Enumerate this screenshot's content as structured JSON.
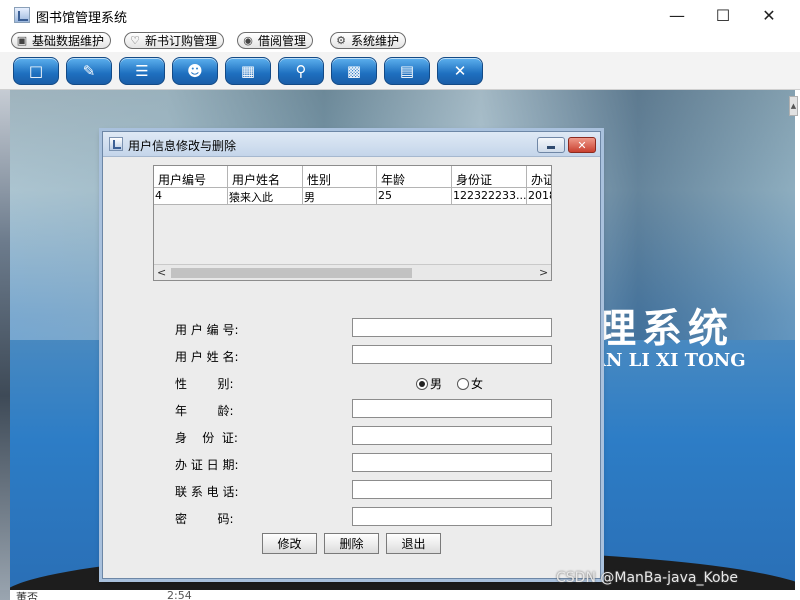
{
  "window": {
    "title": "图书馆管理系统"
  },
  "menu": [
    {
      "label": "基础数据维护",
      "icon": "cube-icon"
    },
    {
      "label": "新书订购管理",
      "icon": "cart-icon"
    },
    {
      "label": "借阅管理",
      "icon": "lock-icon"
    },
    {
      "label": "系统维护",
      "icon": "gears-icon"
    }
  ],
  "toolbar": [
    {
      "icon": "book-icon"
    },
    {
      "icon": "edit-icon"
    },
    {
      "icon": "books-icon"
    },
    {
      "icon": "reader-icon"
    },
    {
      "icon": "box-icon"
    },
    {
      "icon": "search-icon"
    },
    {
      "icon": "monitor-icon"
    },
    {
      "icon": "document-icon"
    },
    {
      "icon": "tools-icon"
    }
  ],
  "background": {
    "banner": "理系统",
    "banner_sub": "AN LI XI TONG",
    "bottom_text": "董否",
    "bottom_time": "2:54"
  },
  "dialog": {
    "title": "用户信息修改与删除",
    "table": {
      "headers": [
        "用户编号",
        "用户姓名",
        "性别",
        "年龄",
        "身份证",
        "办证"
      ],
      "rows": [
        [
          "4",
          "猿来入此",
          "男",
          "25",
          "122322233...",
          "2018"
        ]
      ]
    },
    "form": {
      "user_id_label": "用 户 编 号:",
      "user_name_label": "用 户 姓 名:",
      "gender_label": "性        别:",
      "age_label": "年        龄:",
      "id_card_label": "身    份  证:",
      "issue_date_label": "办 证 日 期:",
      "phone_label": "联 系 电 话:",
      "password_label": "密        码:",
      "gender_options": {
        "male": "男",
        "female": "女",
        "selected": "男"
      }
    },
    "buttons": {
      "modify": "修改",
      "delete": "删除",
      "exit": "退出"
    }
  },
  "watermark": "CSDN @ManBa-java_Kobe"
}
